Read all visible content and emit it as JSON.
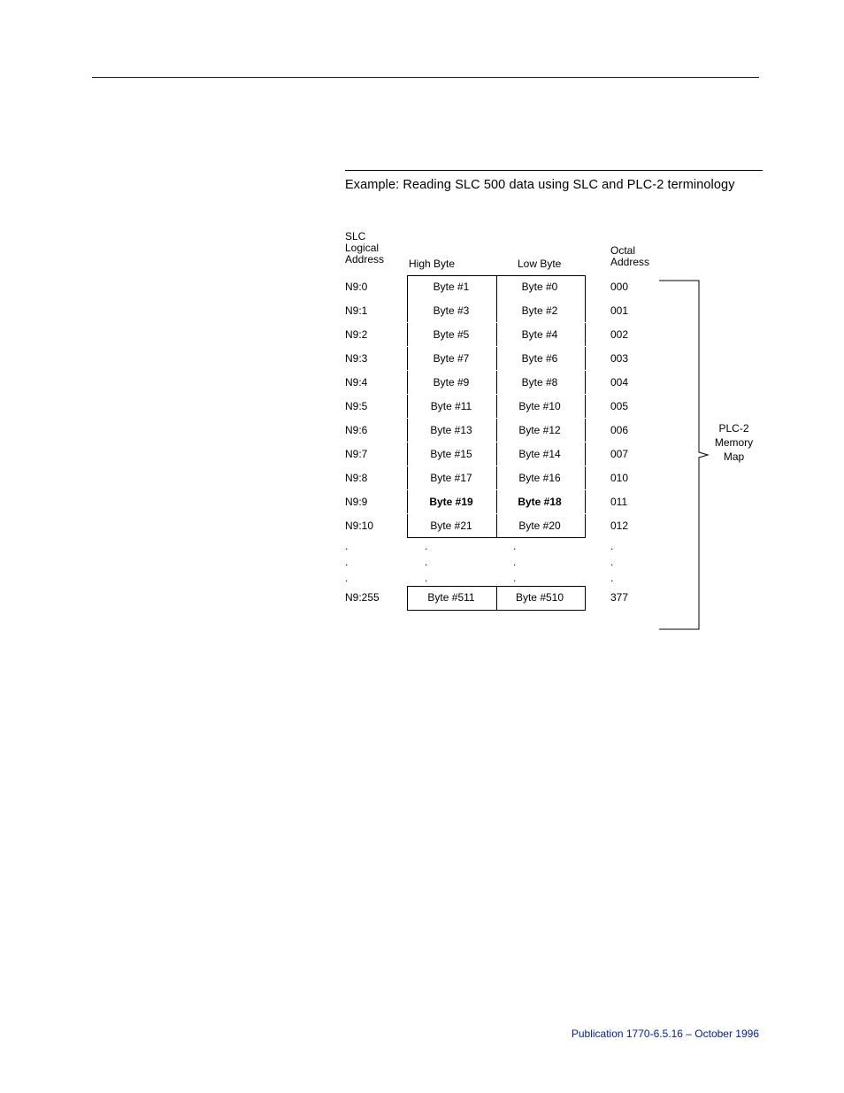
{
  "example_title": "Example:  Reading SLC 500 data using SLC and PLC-2 terminology",
  "headers": {
    "slc_line1": "SLC",
    "slc_line2": "Logical",
    "slc_line3": "Address",
    "high_byte": "High Byte",
    "low_byte": "Low Byte",
    "octal_line1": "Octal",
    "octal_line2": "Address"
  },
  "rows": [
    {
      "slc": "N9:0",
      "high": "Byte  #1",
      "low": "Byte  #0",
      "octal": "000",
      "bold": false
    },
    {
      "slc": "N9:1",
      "high": "Byte  #3",
      "low": "Byte  #2",
      "octal": "001",
      "bold": false
    },
    {
      "slc": "N9:2",
      "high": "Byte  #5",
      "low": "Byte  #4",
      "octal": "002",
      "bold": false
    },
    {
      "slc": "N9:3",
      "high": "Byte  #7",
      "low": "Byte  #6",
      "octal": "003",
      "bold": false
    },
    {
      "slc": "N9:4",
      "high": "Byte  #9",
      "low": "Byte  #8",
      "octal": "004",
      "bold": false
    },
    {
      "slc": "N9:5",
      "high": "Byte  #11",
      "low": "Byte  #10",
      "octal": "005",
      "bold": false
    },
    {
      "slc": "N9:6",
      "high": "Byte  #13",
      "low": "Byte  #12",
      "octal": "006",
      "bold": false
    },
    {
      "slc": "N9:7",
      "high": "Byte  #15",
      "low": "Byte  #14",
      "octal": "007",
      "bold": false
    },
    {
      "slc": "N9:8",
      "high": "Byte  #17",
      "low": "Byte  #16",
      "octal": "010",
      "bold": false
    },
    {
      "slc": "N9:9",
      "high": "Byte  #19",
      "low": "Byte  #18",
      "octal": "011",
      "bold": true
    },
    {
      "slc": "N9:10",
      "high": "Byte  #21",
      "low": "Byte  #20",
      "octal": "012",
      "bold": false
    }
  ],
  "dots": ".",
  "last_row": {
    "slc": "N9:255",
    "high": "Byte  #511",
    "low": "Byte  #510",
    "octal": "377",
    "bold": false
  },
  "plc2_label_line1": "PLC-2",
  "plc2_label_line2": "Memory Map",
  "footer": "Publication 1770-6.5.16 – October 1996"
}
